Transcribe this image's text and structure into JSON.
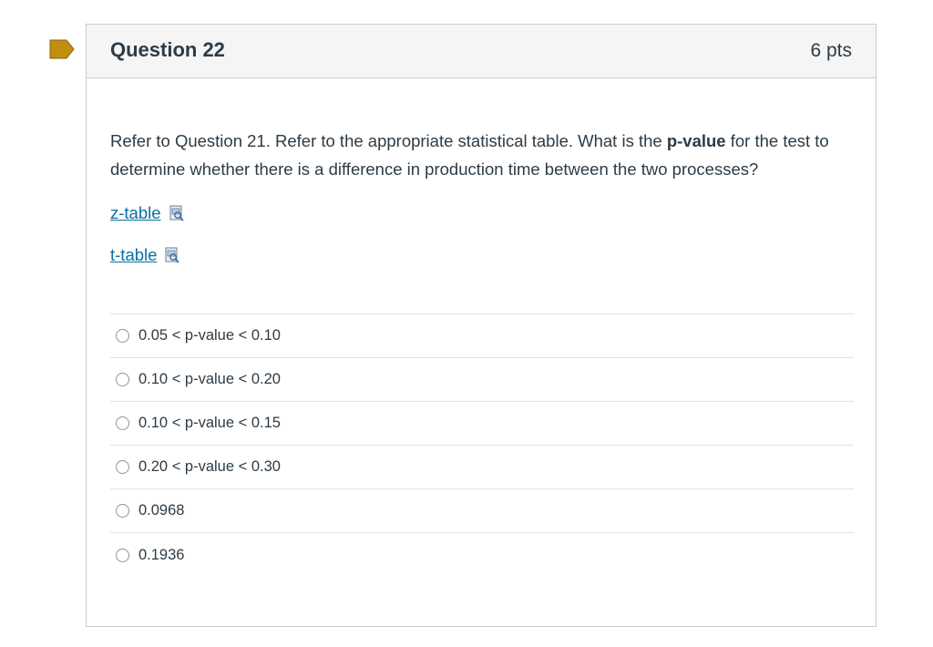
{
  "question": {
    "title": "Question 22",
    "points": "6 pts",
    "text_before": "Refer to Question 21. Refer to the appropriate statistical table. What is the ",
    "text_bold": "p-value",
    "text_after": " for the test to determine whether there is a difference in production time between the two processes?",
    "links": [
      {
        "label": "z-table"
      },
      {
        "label": "t-table"
      }
    ],
    "answers": [
      {
        "label": "0.05 < p-value < 0.10"
      },
      {
        "label": "0.10 < p-value < 0.20"
      },
      {
        "label": "0.10 < p-value < 0.15"
      },
      {
        "label": "0.20 < p-value < 0.30"
      },
      {
        "label": "0.0968"
      },
      {
        "label": "0.1936"
      }
    ]
  },
  "colors": {
    "flag": "#c28e0e",
    "link": "#0770a3",
    "header_bg": "#f5f5f5",
    "border": "#c7cdd1"
  }
}
